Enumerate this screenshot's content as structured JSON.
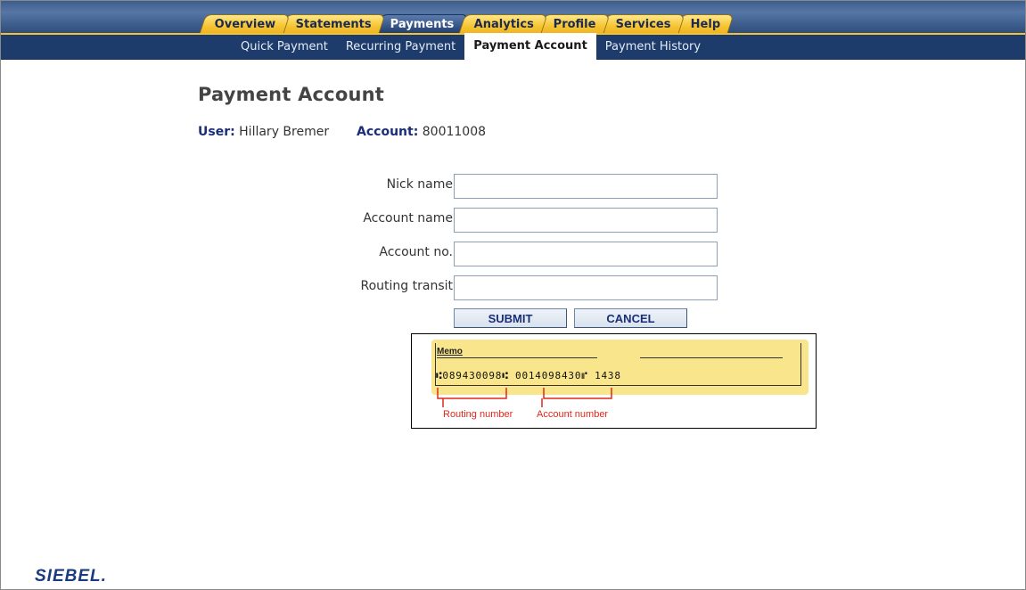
{
  "tabs": [
    {
      "label": "Overview",
      "active": false
    },
    {
      "label": "Statements",
      "active": false
    },
    {
      "label": "Payments",
      "active": true
    },
    {
      "label": "Analytics",
      "active": false
    },
    {
      "label": "Profile",
      "active": false
    },
    {
      "label": "Services",
      "active": false
    },
    {
      "label": "Help",
      "active": false
    }
  ],
  "subnav": [
    {
      "label": "Quick Payment",
      "active": false
    },
    {
      "label": "Recurring Payment",
      "active": false
    },
    {
      "label": "Payment Account",
      "active": true
    },
    {
      "label": "Payment History",
      "active": false
    }
  ],
  "page": {
    "title": "Payment Account",
    "user_label": "User:",
    "user_value": "Hillary Bremer",
    "account_label": "Account:",
    "account_value": "80011008"
  },
  "form": {
    "nick_name": {
      "label": "Nick name",
      "value": ""
    },
    "account_name": {
      "label": "Account name",
      "value": ""
    },
    "account_no": {
      "label": "Account no.",
      "value": ""
    },
    "routing_transit": {
      "label": "Routing transit",
      "value": ""
    },
    "submit_label": "SUBMIT",
    "cancel_label": "CANCEL"
  },
  "check": {
    "memo_label": "Memo",
    "micr_line": "⑆089430098⑆ 0014098430⑈ 1438",
    "routing_label": "Routing number",
    "account_label": "Account number"
  },
  "branding": {
    "logo_text": "SIEBEL."
  },
  "colors": {
    "tab_gold": "#f7c737",
    "nav_blue": "#1d3b6b",
    "label_blue": "#1b2f79",
    "check_yellow": "#f8e58c",
    "annotation_red": "#e0281b"
  }
}
